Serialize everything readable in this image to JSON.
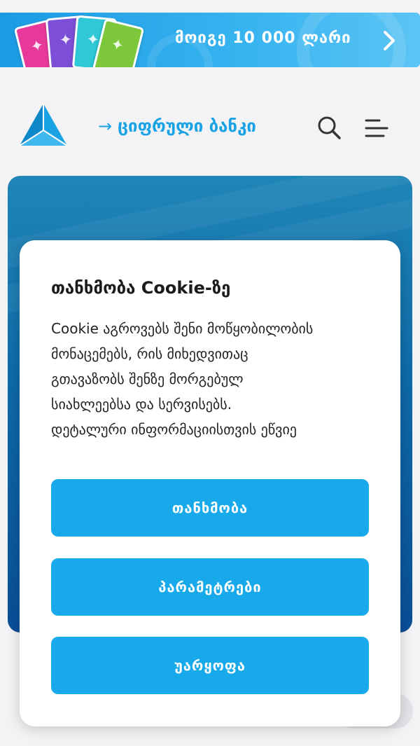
{
  "promo": {
    "text": "მოიგე 10 000 ლარი",
    "chevron_icon": "chevron-right-icon",
    "cards_icon": "dragon-cards-image",
    "colors": [
      "#e8399a",
      "#7d4fd6",
      "#2ec8d6",
      "#7cc83a"
    ]
  },
  "header": {
    "logo_icon": "triangle-logo-icon",
    "digital_bank_arrow": "→",
    "digital_bank_label": "ციფრული ბანკი",
    "search_icon": "search-icon",
    "menu_icon": "menu-icon",
    "accent_color": "#1aa3e4"
  },
  "cookie": {
    "title": "თანხმობა Cookie-ზე",
    "body_lines": [
      "Cookie აგროვებს შენი მოწყობილობის",
      "მონაცემებს, რის მიხედვითაც",
      "გთავაზობს შენზე მორგებულ",
      "სიახლეებსა და სერვისებს.",
      "დეტალური ინფორმაციისთვის ეწვიე"
    ],
    "agree_label": "თანხმობა",
    "params_label": "პარამეტრები",
    "reject_label": "უარყოფა",
    "button_color": "#17a9ea"
  }
}
